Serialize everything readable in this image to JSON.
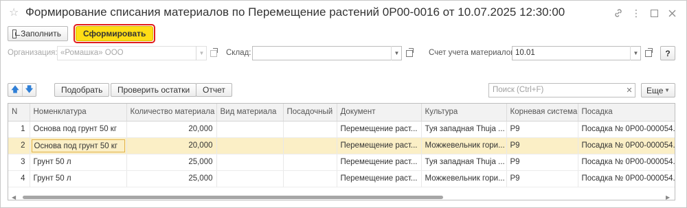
{
  "window": {
    "title": "Формирование списания материалов по Перемещение растений 0Р00-0016 от 10.07.2025 12:30:00",
    "icons": [
      "star-icon",
      "link-icon",
      "more-icon",
      "maximize-icon",
      "close-icon"
    ]
  },
  "toolbar": {
    "fill_label": "Заполнить",
    "generate_label": "Сформировать"
  },
  "form": {
    "organization_label": "Организация:",
    "organization_value": "«Ромашка» ООО",
    "warehouse_label": "Склад:",
    "warehouse_value": "",
    "account_label": "Счет учета материалов:",
    "account_value": "10.01",
    "help_label": "?"
  },
  "table_toolbar": {
    "pick_label": "Подобрать",
    "check_label": "Проверить остатки",
    "report_label": "Отчет",
    "search_placeholder": "Поиск (Ctrl+F)",
    "more_label": "Еще"
  },
  "table": {
    "columns": [
      "N",
      "Номенклатура",
      "Количество материала",
      "Вид материала",
      "Посадочный",
      "Документ",
      "Культура",
      "Корневая система",
      "Посадка"
    ],
    "rows": [
      [
        "1",
        "Основа под грунт 50 кг",
        "20,000",
        "",
        "",
        "Перемещение раст...",
        "Туя западная Thuja ...",
        "Р9",
        "Посадка № 0Р00-000054..."
      ],
      [
        "2",
        "Основа под грунт 50 кг",
        "20,000",
        "",
        "",
        "Перемещение раст...",
        "Можжевельник гори...",
        "Р9",
        "Посадка № 0Р00-000054..."
      ],
      [
        "3",
        "Грунт 50 л",
        "25,000",
        "",
        "",
        "Перемещение раст...",
        "Туя западная Thuja ...",
        "Р9",
        "Посадка № 0Р00-000054..."
      ],
      [
        "4",
        "Грунт 50 л",
        "25,000",
        "",
        "",
        "Перемещение раст...",
        "Можжевельник гори...",
        "Р9",
        "Посадка № 0Р00-000054..."
      ]
    ],
    "selected_row": 2
  },
  "colors": {
    "primary_button": "#ffdd15",
    "highlight_border": "#e21b1b",
    "selected_row": "#fbefc6",
    "arrow_blue": "#2f7fd6"
  }
}
